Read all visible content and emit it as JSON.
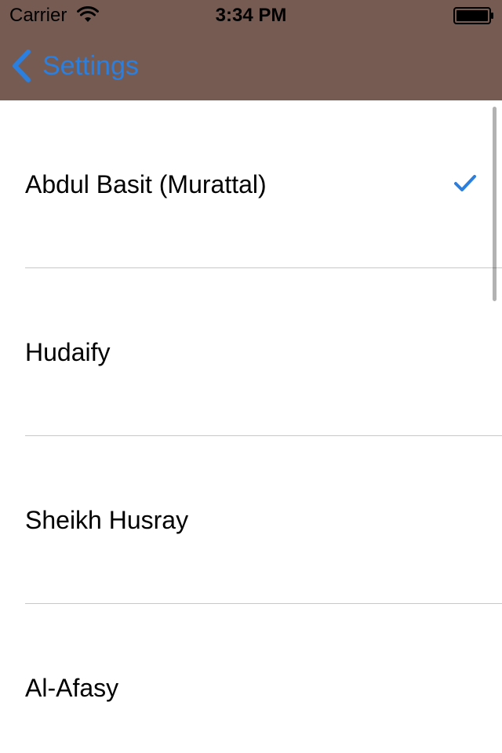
{
  "status_bar": {
    "carrier": "Carrier",
    "time": "3:34 PM",
    "wifi_icon": "wifi-icon",
    "battery_icon": "battery-icon"
  },
  "nav": {
    "back_label": "Settings",
    "back_icon": "chevron-left-icon"
  },
  "list": {
    "items": [
      {
        "label": "Abdul Basit (Murattal)",
        "selected": true
      },
      {
        "label": "Hudaify",
        "selected": false
      },
      {
        "label": "Sheikh Husray",
        "selected": false
      },
      {
        "label": "Al-Afasy",
        "selected": false
      }
    ]
  },
  "colors": {
    "nav_background": "#765b53",
    "accent": "#2b7fde",
    "separator": "#c8c7cc"
  }
}
